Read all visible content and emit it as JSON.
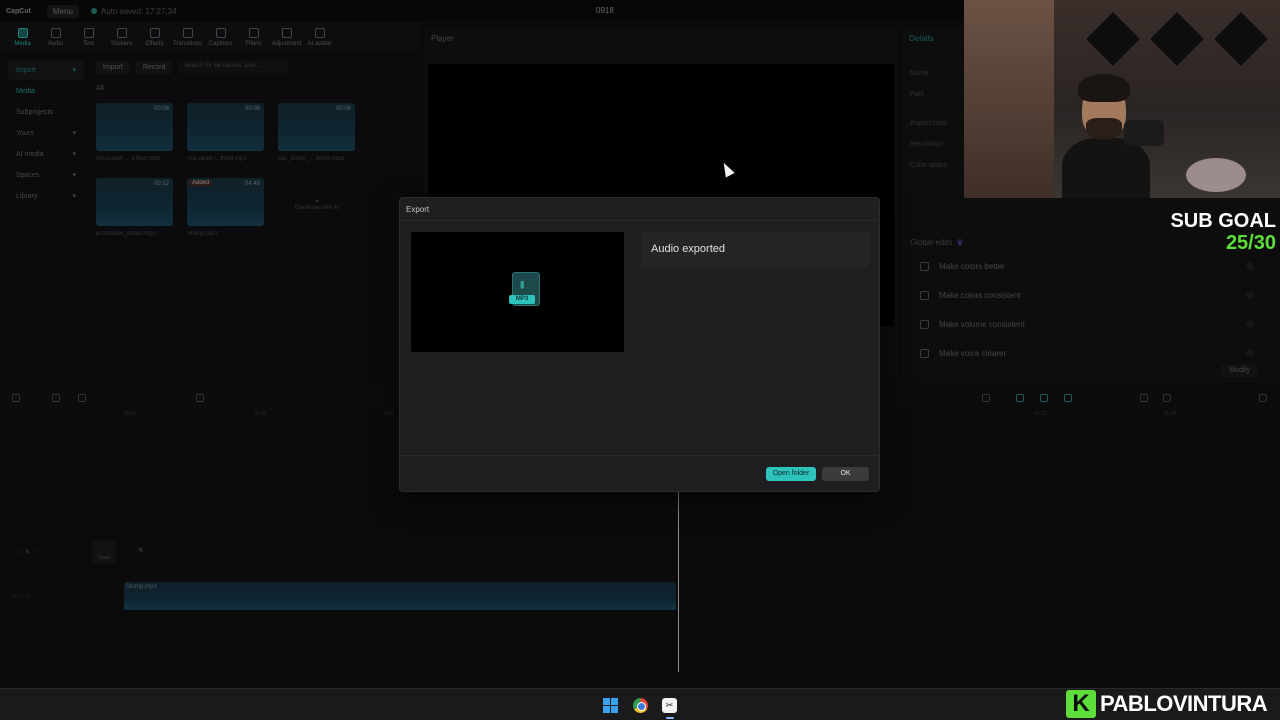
{
  "titlebar": {
    "logo": "CapCut",
    "menu": "Menu",
    "autosave": "Auto saved: 17:27:34",
    "project": "0918"
  },
  "toolbar": {
    "items": [
      {
        "label": "Media",
        "active": true
      },
      {
        "label": "Audio"
      },
      {
        "label": "Text"
      },
      {
        "label": "Stickers"
      },
      {
        "label": "Effects"
      },
      {
        "label": "Transitions"
      },
      {
        "label": "Captions"
      },
      {
        "label": "Filters"
      },
      {
        "label": "Adjustment"
      },
      {
        "label": "AI avatar"
      }
    ]
  },
  "leftnav": {
    "items": [
      "Import",
      "Media",
      "Subprojects",
      "Yours",
      "AI media",
      "Spaces",
      "Library"
    ]
  },
  "media": {
    "import": "Import",
    "record": "Record",
    "search_placeholder": "Search for file names, icon...",
    "filter_all": "All",
    "items": [
      {
        "name": "GIGsubah ... Effect.mp3",
        "duration": "00:06"
      },
      {
        "name": "You need f...thing.mp3",
        "duration": "00:08"
      },
      {
        "name": "sax_boom_... boom.mp3",
        "duration": "00:06"
      },
      {
        "name": "jetShooter_indian.mp3",
        "duration": "00:12"
      },
      {
        "name": "Stomp.mp3",
        "duration": "04:48",
        "badge": "Added"
      }
    ],
    "generate": "Generate with AI"
  },
  "player": {
    "label": "Player"
  },
  "details": {
    "label": "Details",
    "fields": [
      "Name",
      "Path",
      "Aspect ratio",
      "Resolution",
      "Color space"
    ],
    "global_edits": "Global edits",
    "edits": [
      "Make colors better",
      "Make colors consistent",
      "Make volume consistent",
      "Make voice clearer"
    ],
    "modify": "Modify"
  },
  "ruler": {
    "ticks": [
      "00:00",
      "00:03",
      "00:0",
      "00:21",
      "00:24"
    ]
  },
  "timeline": {
    "cover": "Cover",
    "clip_name": "Stomp.mp3"
  },
  "dialog": {
    "title": "Export",
    "file_tag": "MP3",
    "status": "Audio exported",
    "open_folder": "Open folder",
    "ok": "OK"
  },
  "overlay": {
    "sub_goal_label": "SUB GOAL",
    "sub_goal_value": "25/30",
    "brand": "PABLOVINTURA",
    "brand_mark": "K"
  },
  "taskbar": {
    "capcut_glyph": "✂"
  },
  "colors": {
    "accent": "#2fc3bd",
    "sub_goal": "#5dde3a"
  }
}
